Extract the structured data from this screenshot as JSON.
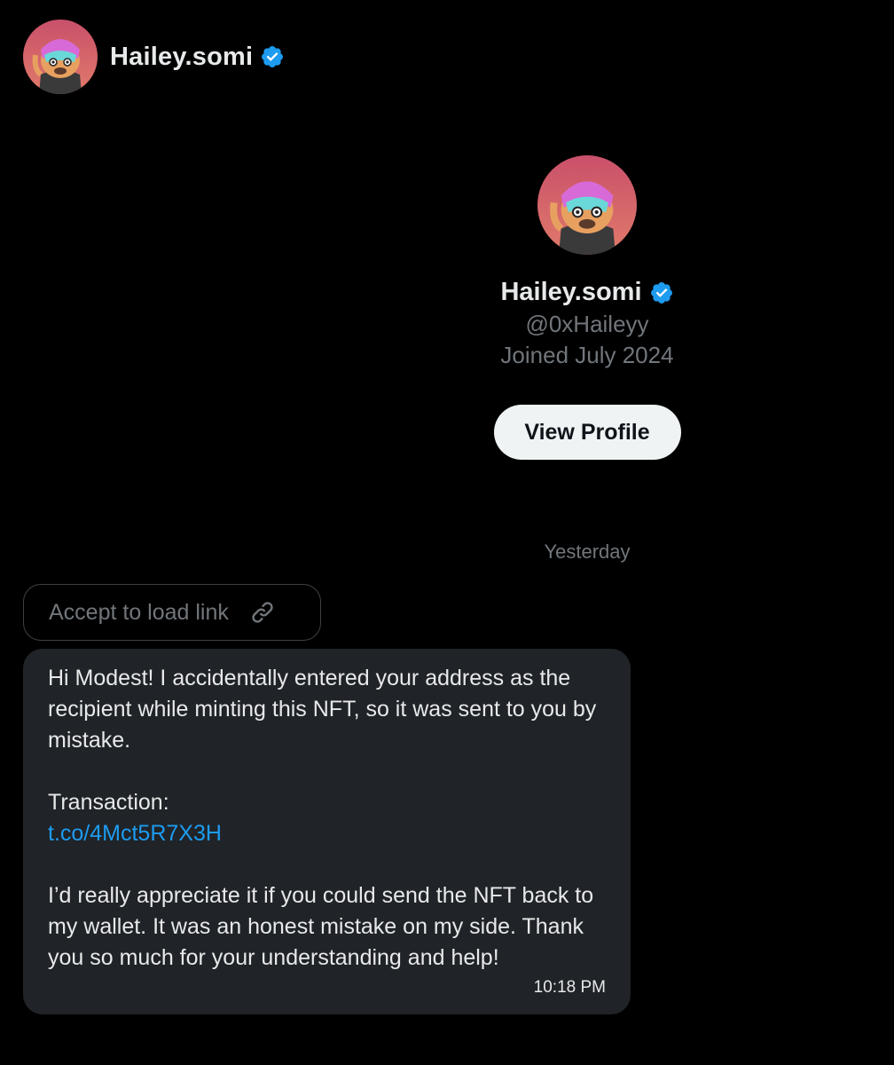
{
  "header": {
    "name": "Hailey.somi"
  },
  "profile": {
    "name": "Hailey.somi",
    "handle": "@0xHaileyy",
    "joined": "Joined July 2024",
    "view_profile_label": "View Profile"
  },
  "conversation": {
    "date_divider": "Yesterday",
    "accept_link_label": "Accept to load link",
    "message": {
      "paragraph1": "Hi Modest! I accidentally entered your address as the recipient while minting this NFT, so it was sent to you by mistake.",
      "transaction_label": "Transaction:",
      "transaction_link": "t.co/4Mct5R7X3H",
      "paragraph3": "I’d really appreciate it if you could send the NFT back to my wallet. It was an honest mistake on my side. Thank you so much for your understanding and help!",
      "time": "10:18 PM"
    }
  },
  "icons": {
    "verified": "verified-badge-icon",
    "link": "link-icon"
  },
  "colors": {
    "background": "#000000",
    "bubble": "#202327",
    "link": "#1d9bf0",
    "verified": "#1d9bf0",
    "muted": "#71767b",
    "button": "#eff3f4"
  }
}
